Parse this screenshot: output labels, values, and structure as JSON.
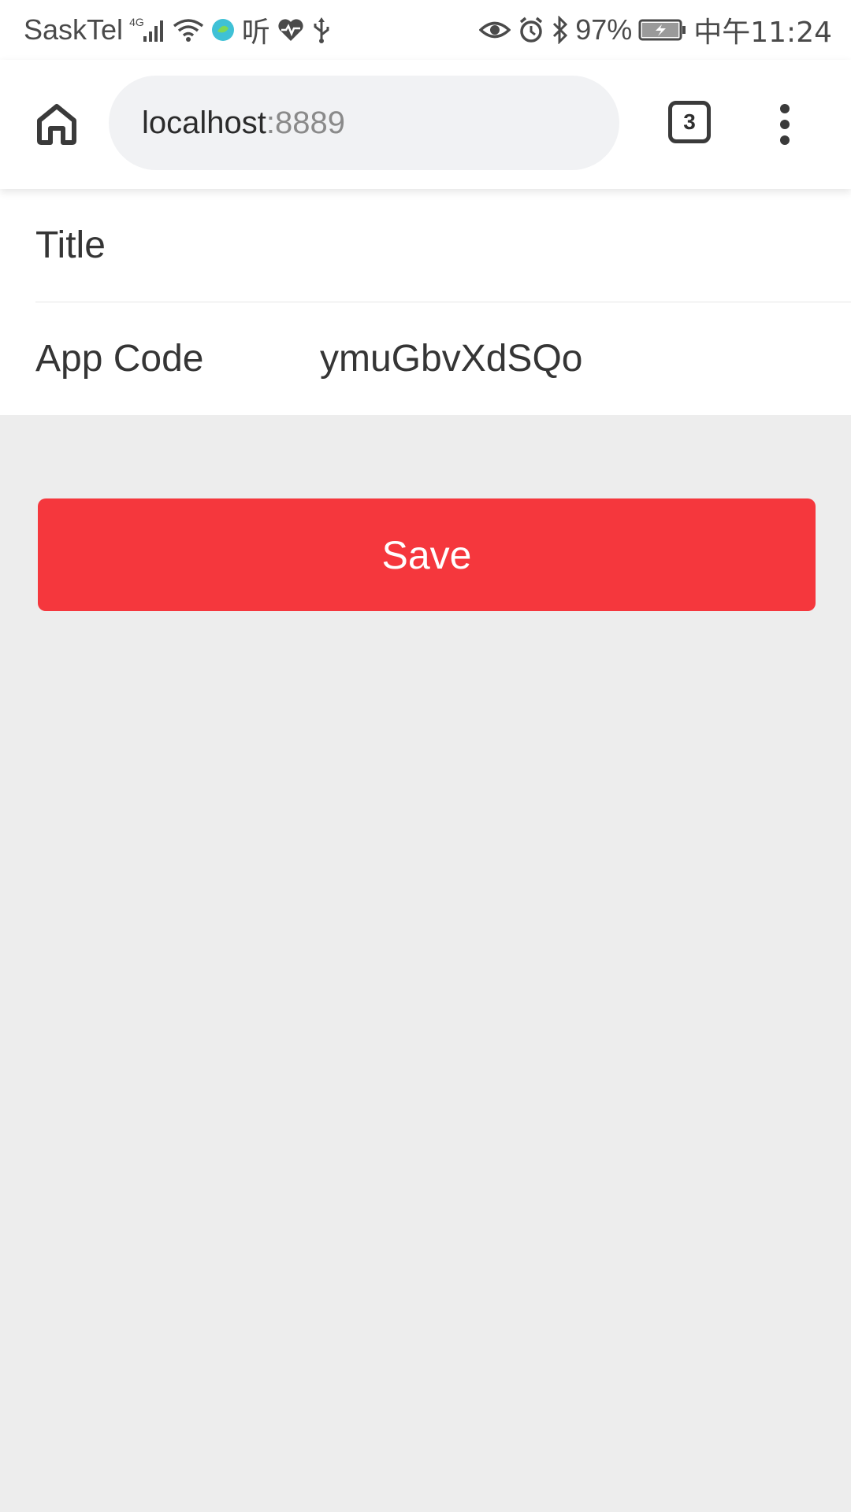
{
  "status_bar": {
    "carrier": "SaskTel",
    "network": "4G",
    "listen_label": "听",
    "battery_percent": "97%",
    "time": "中午11:24"
  },
  "browser": {
    "url_host": "localhost",
    "url_port": ":8889",
    "tab_count": "3"
  },
  "form": {
    "title_label": "Title",
    "title_value": "",
    "app_code_label": "App Code",
    "app_code_value": "ymuGbvXdSQo"
  },
  "actions": {
    "save_label": "Save"
  },
  "colors": {
    "accent": "#f5373d",
    "background": "#ededed",
    "url_bar": "#f1f2f4"
  },
  "icons": {
    "home": "home-icon",
    "menu": "more-vert-icon",
    "signal": "signal-icon",
    "wifi": "wifi-icon",
    "eye": "eye-icon",
    "alarm": "alarm-icon",
    "bluetooth": "bluetooth-icon",
    "battery": "battery-charging-icon",
    "heart": "heart-rate-icon",
    "usb": "usb-icon"
  }
}
